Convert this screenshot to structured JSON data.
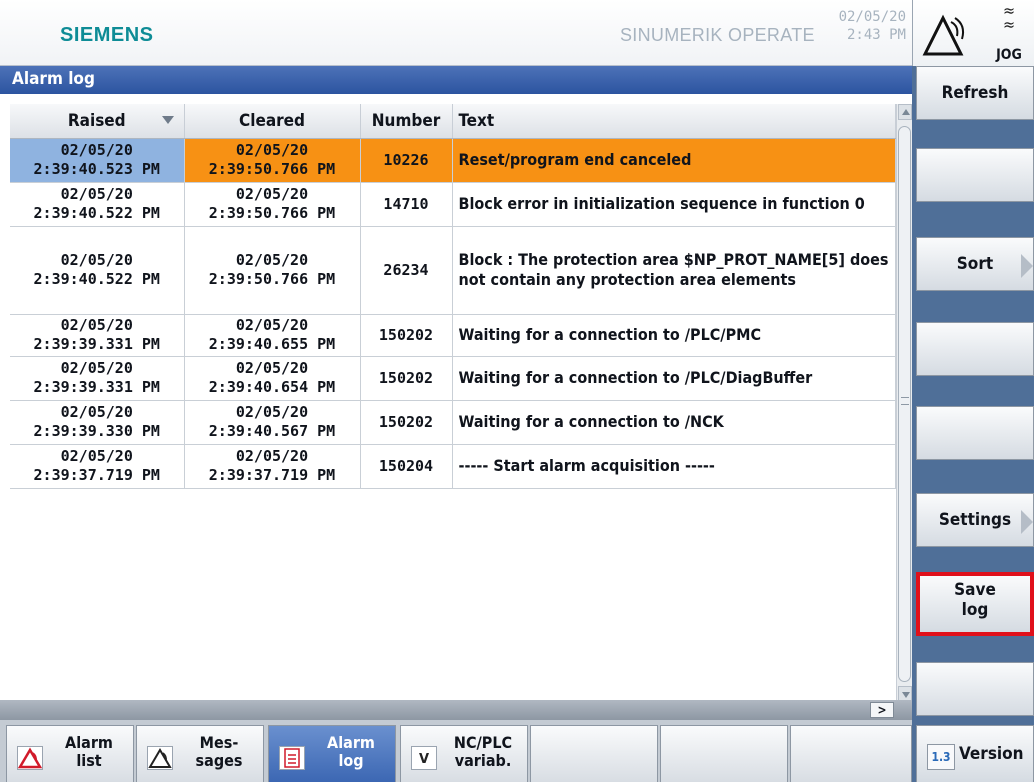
{
  "header": {
    "brand": "SIEMENS",
    "product": "SINUMERIK OPERATE",
    "date": "02/05/20",
    "time": "2:43 PM",
    "mode": "JOG",
    "channel_icon": "channel-state-icon",
    "mode_icon": "jog-mode-icon"
  },
  "title": "Alarm log",
  "table": {
    "columns": [
      "Raised",
      "Cleared",
      "Number",
      "Text"
    ],
    "sort_column": "Raised",
    "rows": [
      {
        "raised_date": "02/05/20",
        "raised_time": "2:39:40.523 PM",
        "cleared_date": "02/05/20",
        "cleared_time": "2:39:50.766 PM",
        "number": "10226",
        "text": "Reset/program end canceled",
        "highlighted": true
      },
      {
        "raised_date": "02/05/20",
        "raised_time": "2:39:40.522 PM",
        "cleared_date": "02/05/20",
        "cleared_time": "2:39:50.766 PM",
        "number": "14710",
        "text": "Block  error in initialization sequence in function 0",
        "highlighted": false
      },
      {
        "raised_date": "02/05/20",
        "raised_time": "2:39:40.522 PM",
        "cleared_date": "02/05/20",
        "cleared_time": "2:39:50.766 PM",
        "number": "26234",
        "text": "Block : The protection area $NP_PROT_NAME[5] does not contain any protection area elements",
        "highlighted": false
      },
      {
        "raised_date": "02/05/20",
        "raised_time": "2:39:39.331 PM",
        "cleared_date": "02/05/20",
        "cleared_time": "2:39:40.655 PM",
        "number": "150202",
        "text": "Waiting for a connection to /PLC/PMC",
        "highlighted": false
      },
      {
        "raised_date": "02/05/20",
        "raised_time": "2:39:39.331 PM",
        "cleared_date": "02/05/20",
        "cleared_time": "2:39:40.654 PM",
        "number": "150202",
        "text": "Waiting for a connection to /PLC/DiagBuffer",
        "highlighted": false
      },
      {
        "raised_date": "02/05/20",
        "raised_time": "2:39:39.330 PM",
        "cleared_date": "02/05/20",
        "cleared_time": "2:39:40.567 PM",
        "number": "150202",
        "text": "Waiting for a connection to /NCK",
        "highlighted": false
      },
      {
        "raised_date": "02/05/20",
        "raised_time": "2:39:37.719 PM",
        "cleared_date": "02/05/20",
        "cleared_time": "2:39:37.719 PM",
        "number": "150204",
        "text": "----- Start alarm acquisition -----",
        "highlighted": false
      }
    ]
  },
  "hscroll_label": ">",
  "softkeys_vertical": [
    {
      "label": "Refresh",
      "has_arrow": false
    },
    {
      "label": "",
      "has_arrow": false
    },
    {
      "label": "Sort",
      "has_arrow": true
    },
    {
      "label": "",
      "has_arrow": false
    },
    {
      "label": "",
      "has_arrow": false
    },
    {
      "label": "Settings",
      "has_arrow": true
    },
    {
      "label_line1": "Save",
      "label_line2": "log",
      "has_arrow": false,
      "highlighted_box_color": "#e0101a"
    },
    {
      "label": "",
      "has_arrow": false
    }
  ],
  "softkeys_horizontal": [
    {
      "line1": "Alarm",
      "line2": "list",
      "icon": "alarm-list-icon",
      "active": false
    },
    {
      "line1": "Mes-",
      "line2": "sages",
      "icon": "messages-icon",
      "active": false
    },
    {
      "line1": "Alarm",
      "line2": "log",
      "icon": "alarm-log-icon",
      "active": true
    },
    {
      "line1": "NC/PLC",
      "line2": "variab.",
      "icon": "variable-icon",
      "active": false
    },
    {
      "line1": "",
      "line2": "",
      "active": false
    },
    {
      "line1": "",
      "line2": "",
      "active": false
    },
    {
      "line1": "",
      "line2": "",
      "active": false
    }
  ],
  "version_key": {
    "label": "Version",
    "icon": "version-icon",
    "icon_text": "1.3"
  },
  "colors": {
    "accent_orange": "#f79114",
    "selection_blue": "#8fb3e0",
    "title_bar": "#2c54a0",
    "brand_teal": "#0e8c96",
    "save_highlight": "#e0101a"
  }
}
